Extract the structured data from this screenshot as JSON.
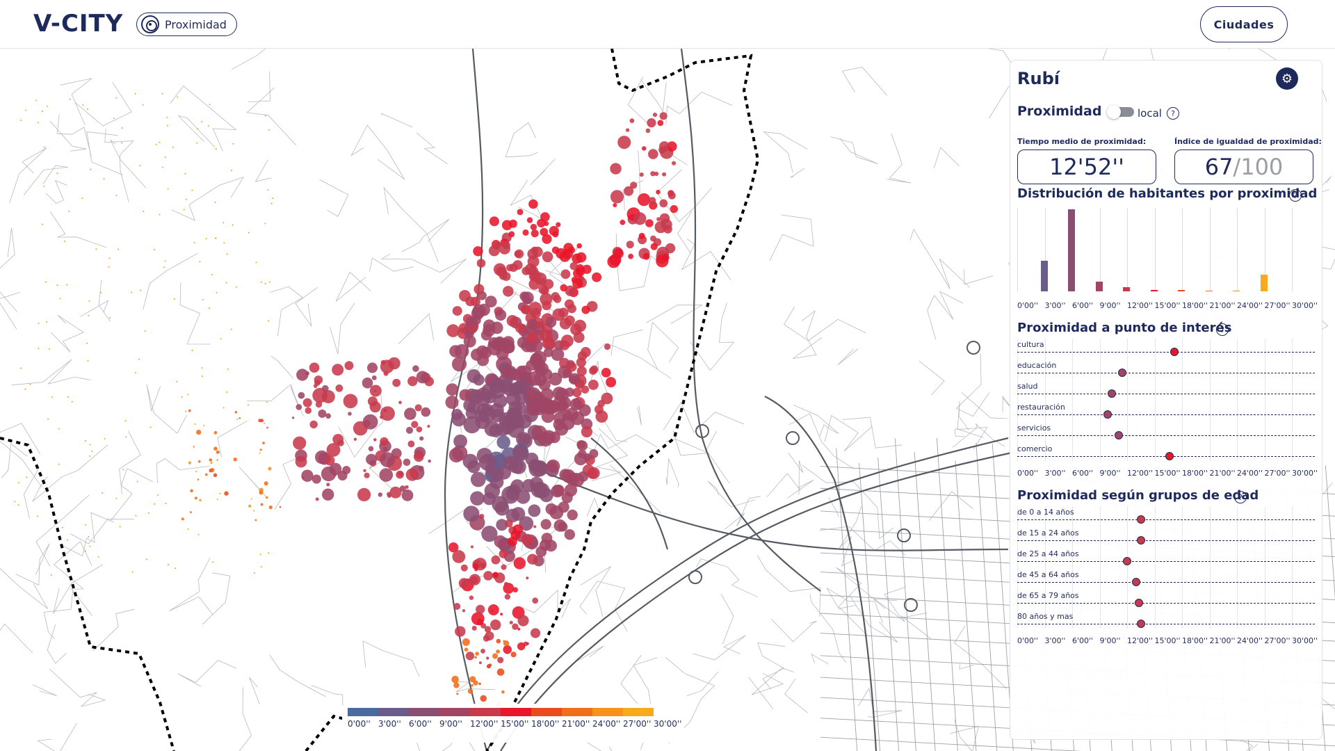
{
  "header": {
    "logo": "V-CITY",
    "mode_label": "Proximidad",
    "cities_label": "Ciudades"
  },
  "colors": {
    "navy": "#1f2a5c",
    "scale": [
      "#4a6aa0",
      "#6a5d8c",
      "#8b4e73",
      "#a24565",
      "#c73a4c",
      "#e8162b",
      "#ea4a1c",
      "#ef6e1a",
      "#f4921a",
      "#f7aa1c"
    ]
  },
  "legend": {
    "labels": [
      "0'00''",
      "3'00''",
      "6'00''",
      "9'00''",
      "12'00''",
      "15'00''",
      "18'00''",
      "21'00''",
      "24'00''",
      "27'00''",
      "30'00''"
    ]
  },
  "panel": {
    "city": "Rubí",
    "settings_icon": "gear-icon",
    "proximity_label": "Proximidad",
    "toggle_label": "local",
    "avg_time_label": "Tiempo medio de proximidad:",
    "avg_time_value": "12'52''",
    "equality_label": "Índice de igualdad de proximidad:",
    "equality_value": "67",
    "equality_max": "/100",
    "histogram_title": "Distribución de habitantes por proximidad",
    "poi_title": "Proximidad a punto de interés",
    "age_title": "Proximidad según grupos de edad",
    "axis_labels": [
      "0'00''",
      "3'00''",
      "6'00''",
      "9'00''",
      "12'00''",
      "15'00''",
      "18'00''",
      "21'00''",
      "24'00''",
      "27'00''",
      "30'00''"
    ]
  },
  "chart_data": [
    {
      "type": "bar",
      "title": "Distribución de habitantes por proximidad",
      "categories": [
        "3'00''",
        "6'00''",
        "9'00''",
        "12'00''",
        "15'00''",
        "18'00''",
        "21'00''",
        "24'00''",
        "27'00''"
      ],
      "values": [
        37,
        100,
        12,
        5,
        2,
        2,
        1,
        1,
        20
      ],
      "colors": [
        "#6a5d8c",
        "#8b4e73",
        "#a24565",
        "#c73a4c",
        "#e8162b",
        "#ea4a1c",
        "#ef6e1a",
        "#f4921a",
        "#f7aa1c"
      ],
      "xlim": [
        0,
        30
      ]
    },
    {
      "type": "scatter",
      "title": "Proximidad a punto de interés",
      "categories": [
        "cultura",
        "educación",
        "salud",
        "restauración",
        "servicios",
        "comercio"
      ],
      "values": [
        17.2,
        11.5,
        10.3,
        9.9,
        11.1,
        16.6
      ],
      "xlim": [
        0,
        30
      ]
    },
    {
      "type": "scatter",
      "title": "Proximidad según grupos de edad",
      "categories": [
        "de 0 a 14 años",
        "de 15 a 24 años",
        "de 25 a 44 años",
        "de 45 a 64 años",
        "de 65 a 79 años",
        "80 años y mas"
      ],
      "values": [
        13.5,
        13.5,
        12.0,
        13.0,
        13.3,
        13.5
      ],
      "xlim": [
        0,
        30
      ]
    }
  ]
}
